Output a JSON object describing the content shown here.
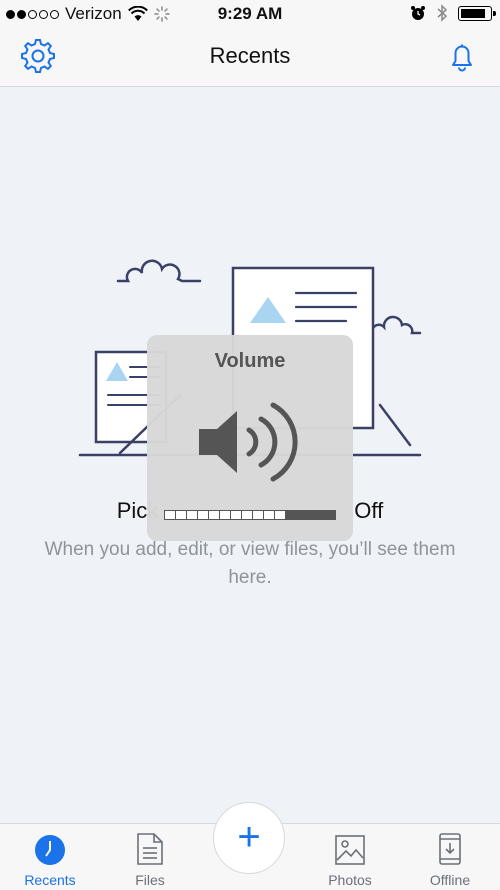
{
  "status_bar": {
    "carrier": "Verizon",
    "time": "9:29 AM",
    "signal_strength": 2,
    "battery_level": 0.9,
    "icons": [
      "signal-icon",
      "wifi-icon",
      "activity-spinner-icon",
      "alarm-icon",
      "bluetooth-icon",
      "battery-icon"
    ]
  },
  "nav": {
    "title": "Recents",
    "left_icon": "gear-icon",
    "right_icon": "bell-icon",
    "accent": "#1a73e8"
  },
  "empty_state": {
    "heading_left": "Pick",
    "heading_right": "Off",
    "subtext": "When you add, edit, or view files, you’ll see them here."
  },
  "volume_hud": {
    "label": "Volume",
    "level": 0.69,
    "icon": "speaker-icon"
  },
  "tabs": [
    {
      "label": "Recents",
      "icon": "clock-icon",
      "active": true
    },
    {
      "label": "Files",
      "icon": "file-icon",
      "active": false
    },
    {
      "label": "Photos",
      "icon": "photo-icon",
      "active": false
    },
    {
      "label": "Offline",
      "icon": "offline-device-icon",
      "active": false
    }
  ],
  "fab": {
    "icon": "plus-icon",
    "symbol": "+"
  }
}
